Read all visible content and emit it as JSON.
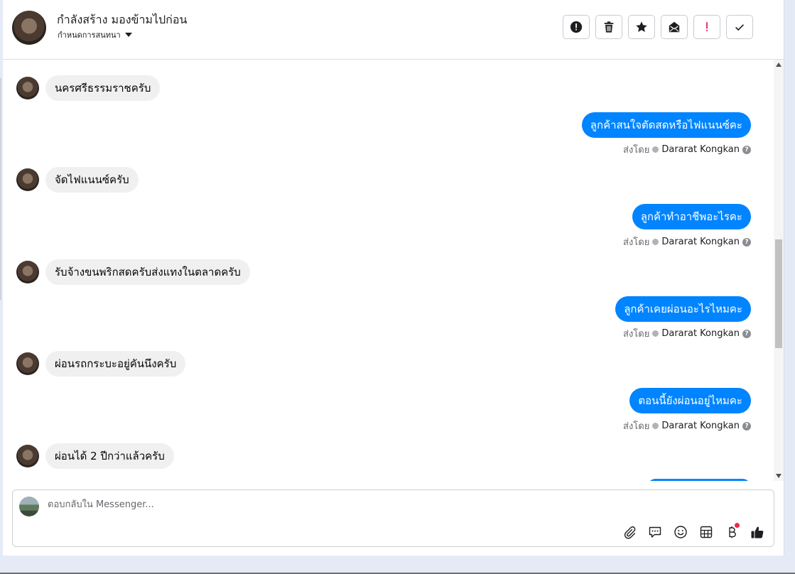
{
  "header": {
    "contact_name": "กำลังสร้าง มองข้ามไปก่อน",
    "assign_label": "กำหนดการสนทนา",
    "toolbar": [
      {
        "name": "spam-button",
        "icon": "alert-circle-icon"
      },
      {
        "name": "delete-button",
        "icon": "trash-icon"
      },
      {
        "name": "star-button",
        "icon": "star-icon"
      },
      {
        "name": "mark-unread-button",
        "icon": "mail-icon"
      },
      {
        "name": "follow-up-button",
        "icon": "exclamation-icon"
      },
      {
        "name": "done-button",
        "icon": "check-icon"
      }
    ]
  },
  "messages": [
    {
      "dir": "in",
      "text": "นครศรีธรรมราชครับ"
    },
    {
      "dir": "out",
      "text": "ลูกค้าสนใจตัดสดหรือไฟแนนซ์คะ",
      "sent_by_label": "ส่งโดย",
      "agent": "Dararat Kongkan"
    },
    {
      "dir": "in",
      "text": "จัดไฟแนนซ์ครับ"
    },
    {
      "dir": "out",
      "text": "ลูกค้าทำอาชีพอะไรคะ",
      "sent_by_label": "ส่งโดย",
      "agent": "Dararat Kongkan"
    },
    {
      "dir": "in",
      "text": "รับจ้างขนพริกสดครับส่งแทงในตลาดครับ"
    },
    {
      "dir": "out",
      "text": "ลูกค้าเคยผ่อนอะไรไหมคะ",
      "sent_by_label": "ส่งโดย",
      "agent": "Dararat Kongkan"
    },
    {
      "dir": "in",
      "text": "ผ่อนรถกระบะอยู่คันนึงครับ"
    },
    {
      "dir": "out",
      "text": "ตอนนี้ยังผ่อนอยู่ไหมคะ",
      "sent_by_label": "ส่งโดย",
      "agent": "Dararat Kongkan"
    },
    {
      "dir": "in",
      "text": "ผ่อนได้ 2 ปีกว่าแล้วครับ"
    }
  ],
  "composer": {
    "placeholder": "ตอบกลับใน Messenger...",
    "icons": [
      "paperclip-icon",
      "saved-reply-icon",
      "emoji-icon",
      "table-icon",
      "baht-icon",
      "thumbs-up-icon"
    ]
  },
  "colors": {
    "accent": "#0084ff",
    "incoming_bubble": "#f0f0f0",
    "badge": "#f02849"
  }
}
